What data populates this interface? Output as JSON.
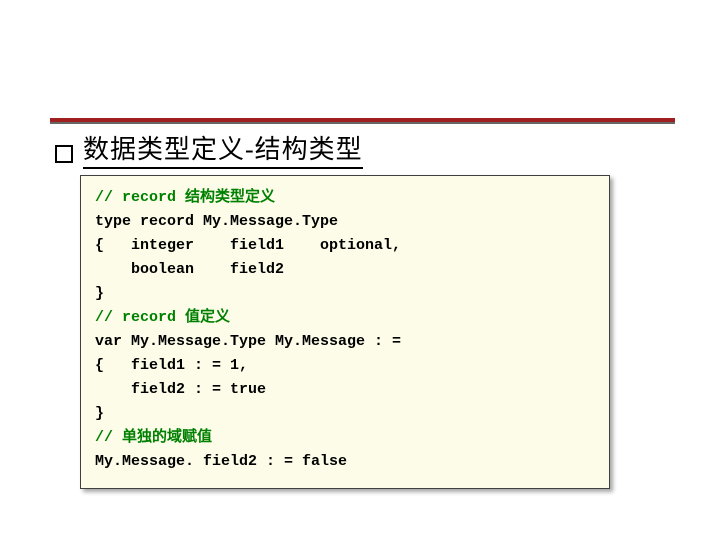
{
  "heading": "数据类型定义-结构类型",
  "code": {
    "c1": "// record 结构类型定义",
    "l2": "type record My.Message.Type",
    "l3": "{   integer    field1    optional,",
    "l4": "    boolean    field2",
    "l5": "}",
    "c2": "// record 值定义",
    "l7": "var My.Message.Type My.Message : =",
    "l8": "{   field1 : = 1,",
    "l9": "    field2 : = true",
    "l10": "}",
    "c3": "// 单独的域赋值",
    "l12": "My.Message. field2 : = false"
  }
}
